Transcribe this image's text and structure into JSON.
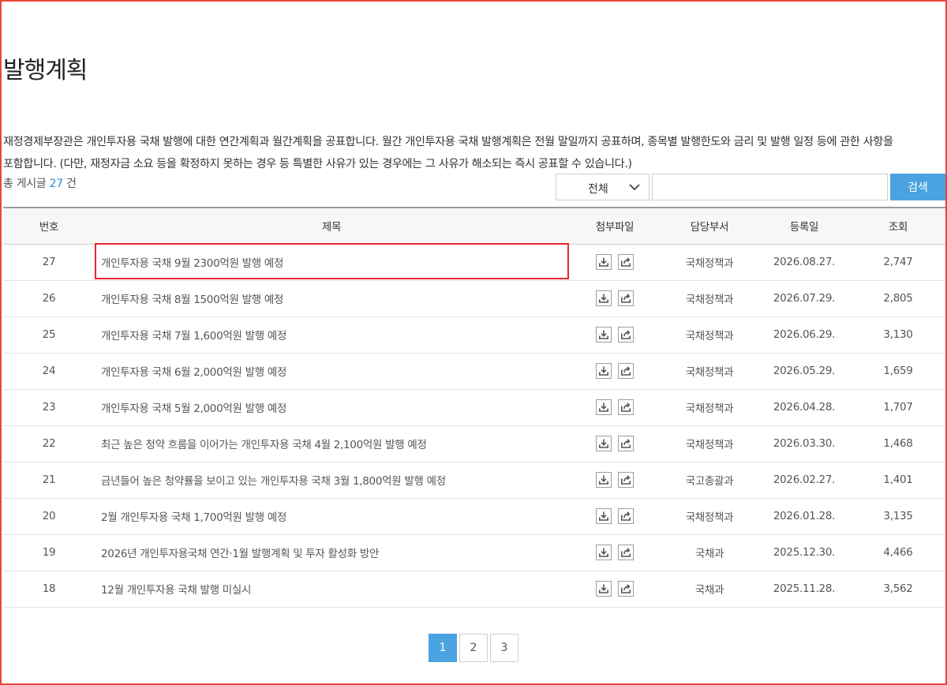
{
  "page": {
    "title": "발행계획",
    "description_line1": "재정경제부장관은 개인투자용 국채 발행에 대한 연간계획과 월간계획을 공표합니다. 월간 개인투자용 국채 발행계획은 전월 말일까지 공표하며, 종목별 발행한도와 금리 및 발행 일정 등에 관한 사항을",
    "description_line2": "포함합니다. (다만, 재정자금 소요 등을 확정하지 못하는 경우 등 특별한 사유가 있는 경우에는 그 사유가 해소되는 즉시 공표할 수 있습니다.)"
  },
  "summary": {
    "prefix": "총 게시글",
    "count": "27",
    "suffix": "건"
  },
  "search": {
    "scope_value": "전체",
    "scope_icon": "chevron-down-icon",
    "input_value": "",
    "button_label": "검색",
    "button_color": "#4aa3e0"
  },
  "table": {
    "columns": [
      "번호",
      "제목",
      "첨부파일",
      "담당부서",
      "등록일",
      "조회"
    ],
    "attachment_icons": [
      "download-icon",
      "share-icon"
    ],
    "rows": [
      {
        "num": "27",
        "title": "개인투자용 국채 9월 2300억원 발행 예정",
        "dept": "국채정책과",
        "date": "2026.08.27.",
        "views": "2,747"
      },
      {
        "num": "26",
        "title": "개인투자용 국채 8월 1500억원 발행 예정",
        "dept": "국채정책과",
        "date": "2026.07.29.",
        "views": "2,805"
      },
      {
        "num": "25",
        "title": "개인투자용 국채 7월 1,600억원 발행 예정",
        "dept": "국채정책과",
        "date": "2026.06.29.",
        "views": "3,130"
      },
      {
        "num": "24",
        "title": "개인투자용 국채 6월 2,000억원 발행 예정",
        "dept": "국채정책과",
        "date": "2026.05.29.",
        "views": "1,659"
      },
      {
        "num": "23",
        "title": "개인투자용 국채 5월 2,000억원 발행 예정",
        "dept": "국채정책과",
        "date": "2026.04.28.",
        "views": "1,707"
      },
      {
        "num": "22",
        "title": "최근 높은 청약 흐름을 이어가는 개인투자용 국채 4월 2,100억원 발행 예정",
        "dept": "국채정책과",
        "date": "2026.03.30.",
        "views": "1,468"
      },
      {
        "num": "21",
        "title": "금년들어 높은 청약률을 보이고 있는 개인투자용 국채 3월 1,800억원 발행 예정",
        "dept": "국고총괄과",
        "date": "2026.02.27.",
        "views": "1,401"
      },
      {
        "num": "20",
        "title": "2월 개인투자용 국채 1,700억원 발행 예정",
        "dept": "국채정책과",
        "date": "2026.01.28.",
        "views": "3,135"
      },
      {
        "num": "19",
        "title": "2026년 개인투자용국채 연간·1월 발행계획 및 투자 활성화 방안",
        "dept": "국채과",
        "date": "2025.12.30.",
        "views": "4,466"
      },
      {
        "num": "18",
        "title": "12월 개인투자용 국채 발행 미실시",
        "dept": "국채과",
        "date": "2025.11.28.",
        "views": "3,562"
      }
    ]
  },
  "pagination": {
    "pages": [
      "1",
      "2",
      "3"
    ],
    "current": "1",
    "active_color": "#4aa3e0"
  },
  "highlight": {
    "color": "#e8262b"
  }
}
